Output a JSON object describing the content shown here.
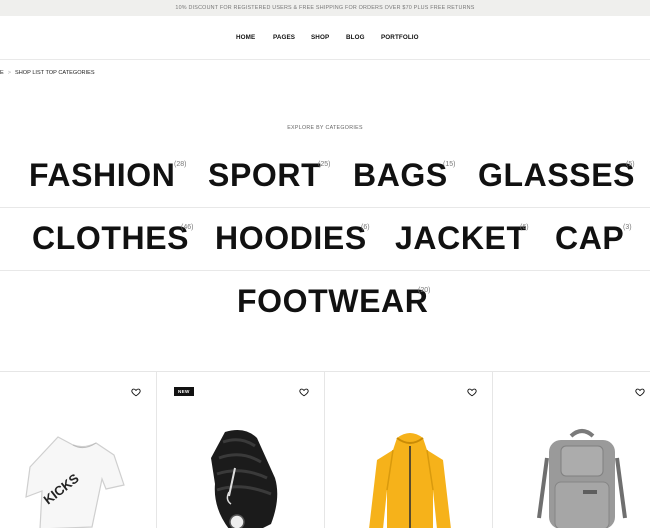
{
  "announcement": "10% discount for registered users & free shipping for orders over $70 plus free returns",
  "nav": {
    "items": [
      "HOME",
      "PAGES",
      "SHOP",
      "BLOG",
      "PORTFOLIO"
    ]
  },
  "breadcrumb": {
    "home": "E",
    "separator": ">",
    "current": "SHOP LIST TOP CATEGORIES"
  },
  "explore_label": "EXPLORE BY CATEGORIES",
  "categories": [
    {
      "name": "FASHION",
      "count": "(28)"
    },
    {
      "name": "SPORT",
      "count": "(25)"
    },
    {
      "name": "BAGS",
      "count": "(15)"
    },
    {
      "name": "GLASSES",
      "count": "(5)"
    },
    {
      "name": "CLOTHES",
      "count": "(46)"
    },
    {
      "name": "HOODIES",
      "count": "(6)"
    },
    {
      "name": "JACKET",
      "count": "(6)"
    },
    {
      "name": "CAP",
      "count": "(3)"
    },
    {
      "name": "FOOTWEAR",
      "count": "(20)"
    }
  ],
  "products": [
    {
      "image": "white-tshirt",
      "badge": "",
      "tshirt_print": "KICKS"
    },
    {
      "image": "black-sneaker",
      "badge": "NEW"
    },
    {
      "image": "yellow-jacket",
      "badge": ""
    },
    {
      "image": "grey-backpack",
      "badge": ""
    }
  ],
  "colors": {
    "text": "#111111",
    "topbar_bg": "#efefed",
    "divider": "#e8e8e8",
    "jacket": "#f6b21a",
    "backpack": "#9a9a9a"
  }
}
